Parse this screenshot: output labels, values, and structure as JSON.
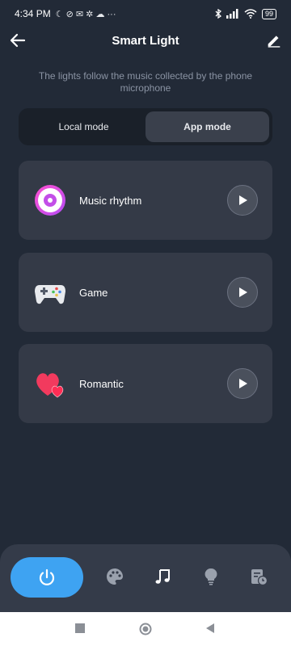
{
  "status_bar": {
    "time": "4:34 PM",
    "left_icons": "☾ ⊘ ✉ ✲ ☁ ···",
    "battery": "99"
  },
  "header": {
    "title": "Smart Light",
    "back_icon": "arrow-left",
    "edit_icon": "pencil"
  },
  "description": "The lights follow the music collected by the phone microphone",
  "mode_toggle": {
    "options": [
      {
        "label": "Local mode",
        "active": false
      },
      {
        "label": "App mode",
        "active": true
      }
    ]
  },
  "cards": [
    {
      "label": "Music rhythm",
      "icon": "music-disc-icon"
    },
    {
      "label": "Game",
      "icon": "gamepad-icon"
    },
    {
      "label": "Romantic",
      "icon": "hearts-icon"
    }
  ],
  "bottom_nav": {
    "items": [
      "power",
      "palette",
      "music",
      "bulb",
      "schedule"
    ],
    "active": "music",
    "accent": "#3ea3f2"
  },
  "colors": {
    "background": "#222a37",
    "card": "#343a47",
    "accent": "#3ea3f2"
  }
}
